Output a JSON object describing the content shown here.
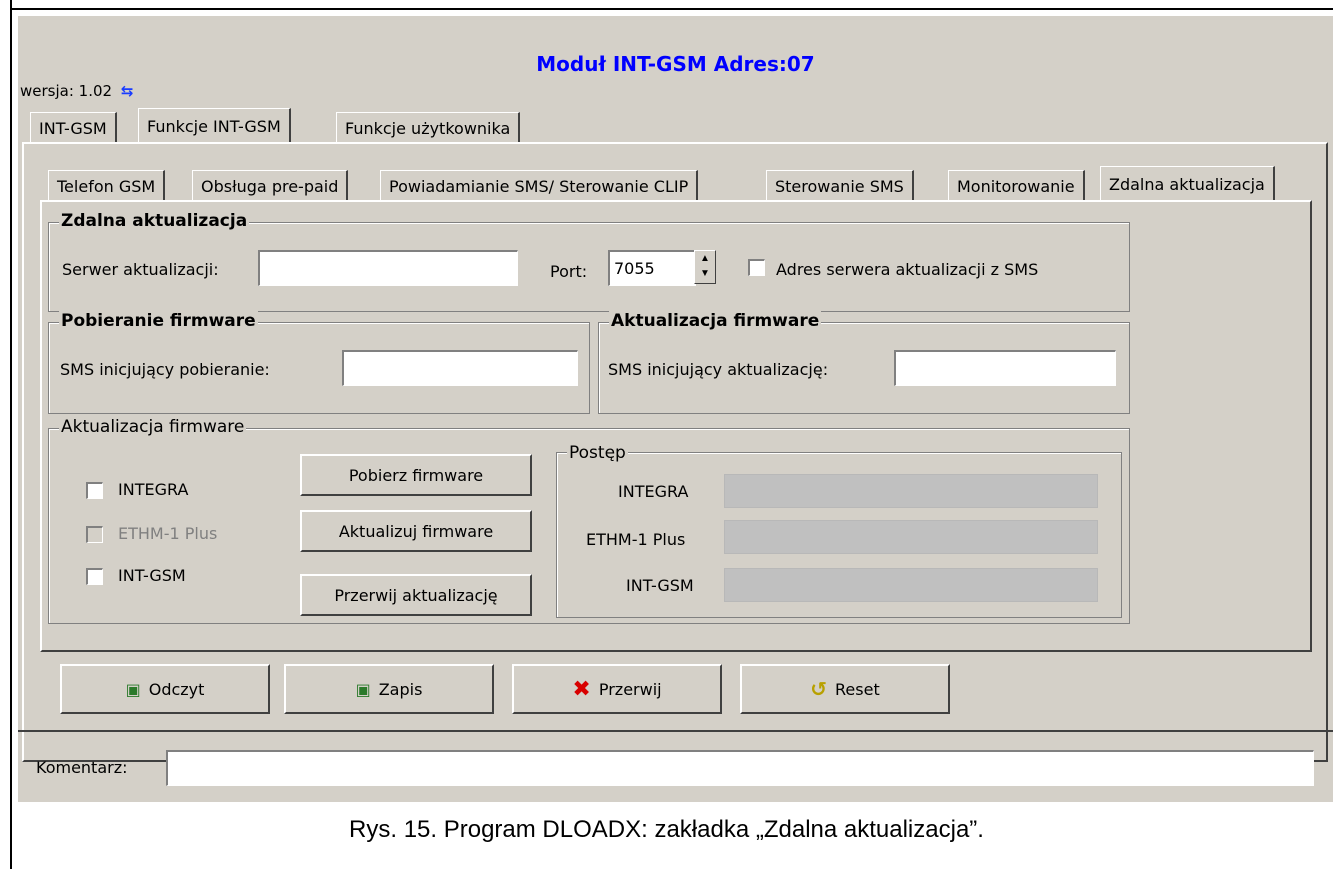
{
  "window": {
    "title": "Moduł INT-GSM Adres:07",
    "version": "wersja: 1.02"
  },
  "main_tabs": [
    {
      "label": "INT-GSM"
    },
    {
      "label": "Funkcje INT-GSM"
    },
    {
      "label": "Funkcje użytkownika"
    }
  ],
  "sub_tabs": [
    {
      "label": "Telefon GSM"
    },
    {
      "label": "Obsługa pre-paid"
    },
    {
      "label": "Powiadamianie SMS/ Sterowanie CLIP"
    },
    {
      "label": "Sterowanie SMS"
    },
    {
      "label": "Monitorowanie"
    },
    {
      "label": "Zdalna aktualizacja"
    }
  ],
  "remote_update": {
    "title": "Zdalna aktualizacja",
    "server_label": "Serwer aktualizacji:",
    "server_value": "",
    "port_label": "Port:",
    "port_value": "7055",
    "sms_address_label": "Adres serwera aktualizacji z SMS"
  },
  "download_firmware": {
    "title": "Pobieranie firmware",
    "sms_label": "SMS inicjujący pobieranie:",
    "sms_value": ""
  },
  "update_firmware": {
    "title": "Aktualizacja firmware",
    "sms_label": "SMS inicjujący aktualizację:",
    "sms_value": ""
  },
  "firmware_update": {
    "title": "Aktualizacja firmware",
    "checkboxes": [
      {
        "label": "INTEGRA"
      },
      {
        "label": "ETHM-1 Plus"
      },
      {
        "label": "INT-GSM"
      }
    ],
    "buttons": {
      "download": "Pobierz firmware",
      "update": "Aktualizuj firmware",
      "abort": "Przerwij aktualizację"
    },
    "progress": {
      "title": "Postęp",
      "items": [
        {
          "label": "INTEGRA",
          "value": 0
        },
        {
          "label": "ETHM-1 Plus",
          "value": 0
        },
        {
          "label": "INT-GSM",
          "value": 0
        }
      ]
    }
  },
  "bottom_buttons": {
    "read": "Odczyt",
    "write": "Zapis",
    "abort": "Przerwij",
    "reset": "Reset"
  },
  "comment": {
    "label": "Komentarz:",
    "value": ""
  },
  "caption": "Rys. 15. Program DLOADX: zakładka „Zdalna aktualizacja”."
}
